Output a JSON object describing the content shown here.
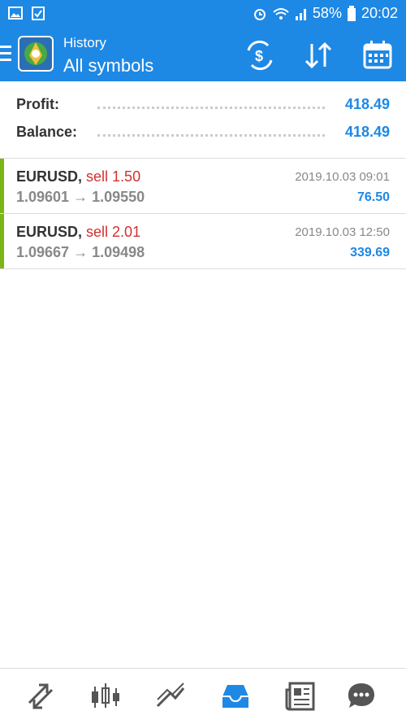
{
  "statusbar": {
    "battery": "58%",
    "time": "20:02"
  },
  "appbar": {
    "small_title": "History",
    "big_title": "All symbols"
  },
  "summary": {
    "profit_label": "Profit:",
    "profit_value": "418.49",
    "balance_label": "Balance:",
    "balance_value": "418.49"
  },
  "deals": [
    {
      "symbol": "EURUSD,",
      "side": "sell 1.50",
      "prices": "1.09601 → 1.09550",
      "date": "2019.10.03 09:01",
      "profit": "76.50"
    },
    {
      "symbol": "EURUSD,",
      "side": "sell 2.01",
      "prices": "1.09667 → 1.09498",
      "date": "2019.10.03 12:50",
      "profit": "339.69"
    }
  ],
  "colors": {
    "accent": "#1e88e5",
    "sell": "#d32f2f",
    "deal_bar": "#7cb518"
  },
  "icons": [
    "image-icon",
    "clipboard-icon",
    "alarm-icon",
    "wifi-icon",
    "signal-icon",
    "battery-icon",
    "menu-icon",
    "metatrader-logo",
    "currency-exchange-icon",
    "sort-icon",
    "calendar-icon",
    "trade-icon",
    "quotes-icon",
    "chart-icon",
    "history-icon",
    "news-icon",
    "chat-icon"
  ]
}
